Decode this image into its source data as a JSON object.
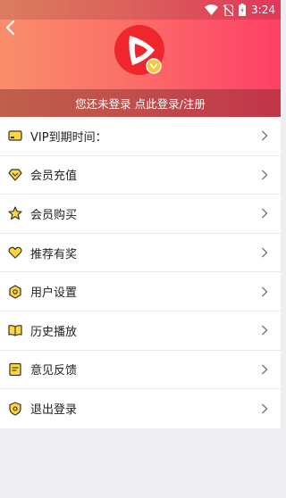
{
  "status": {
    "time": "3:24"
  },
  "header": {
    "login_text": "您还未登录 点此登录/注册"
  },
  "menu": {
    "items": [
      {
        "label": "VIP到期时间：",
        "icon": "vip-card-icon"
      },
      {
        "label": "会员充值",
        "icon": "diamond-icon"
      },
      {
        "label": "会员购买",
        "icon": "star-icon"
      },
      {
        "label": "推荐有奖",
        "icon": "heart-icon"
      },
      {
        "label": "用户设置",
        "icon": "hexagon-icon"
      },
      {
        "label": "历史播放",
        "icon": "book-icon"
      },
      {
        "label": "意见反馈",
        "icon": "document-icon"
      },
      {
        "label": "退出登录",
        "icon": "shield-icon"
      }
    ]
  },
  "colors": {
    "accent": "#fe3f67",
    "icon_fill": "#fcd63c",
    "icon_stroke": "#333333"
  }
}
